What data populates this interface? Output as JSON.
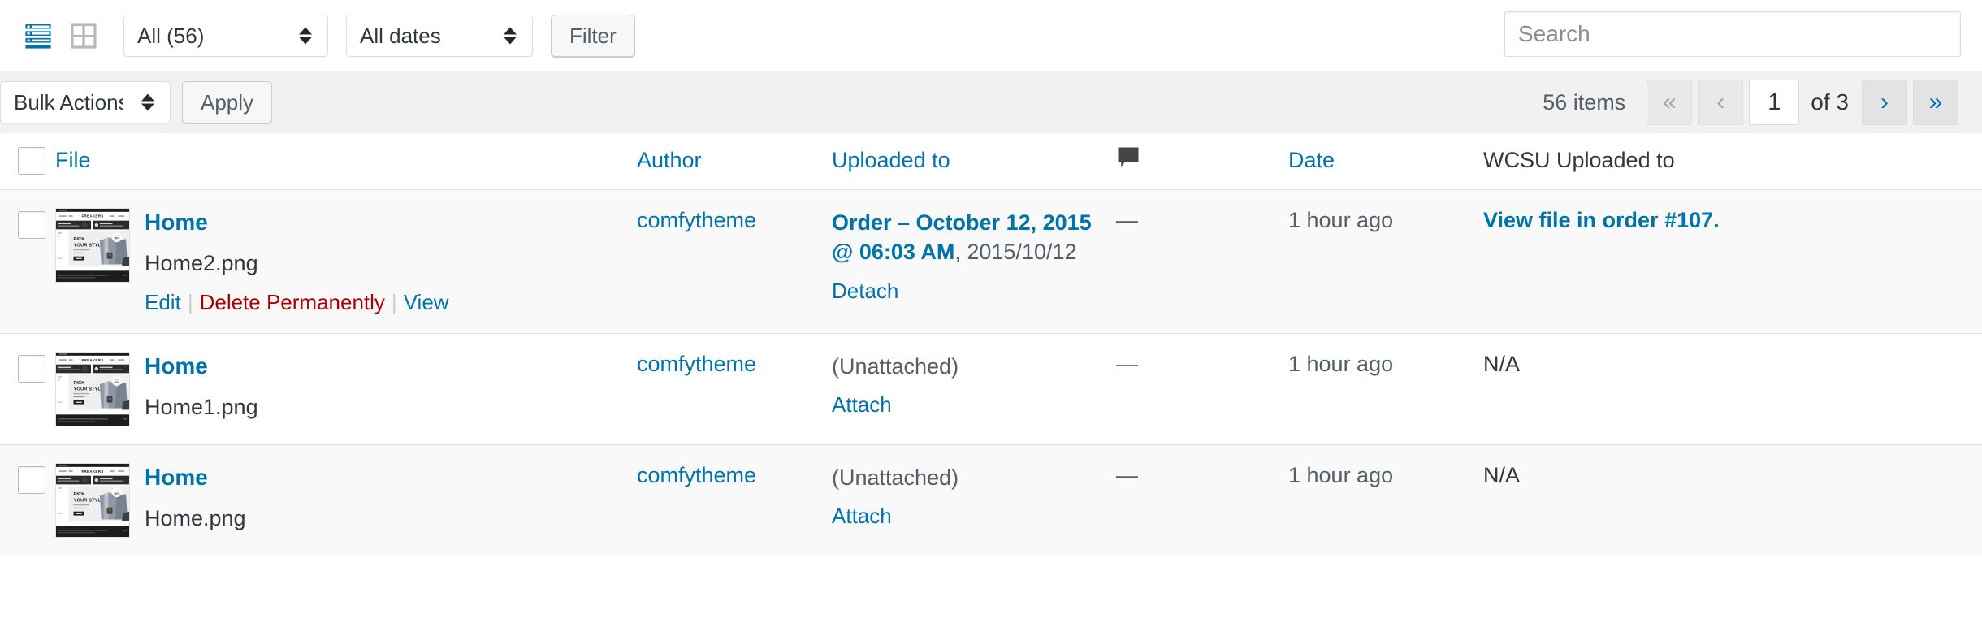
{
  "toolbar": {
    "view_list_icon": "list-view-icon",
    "view_grid_icon": "grid-view-icon",
    "status_filter_value": "All (56)",
    "date_filter_value": "All dates",
    "filter_button_label": "Filter",
    "search_placeholder": "Search",
    "search_value": ""
  },
  "tablenav": {
    "bulk_actions_value": "Bulk Actions",
    "apply_button_label": "Apply",
    "items_count_label": "56 items",
    "first_page_label": "«",
    "prev_page_label": "‹",
    "current_page": "1",
    "total_pages_label": "of 3",
    "next_page_label": "›",
    "last_page_label": "»"
  },
  "table": {
    "columns": {
      "file": "File",
      "author": "Author",
      "uploaded_to": "Uploaded to",
      "comments_icon": "comment-bubble-icon",
      "date": "Date",
      "wcsu_uploaded_to": "WCSU Uploaded to"
    },
    "rows": [
      {
        "title": "Home",
        "filename": "Home2.png",
        "actions": {
          "edit": "Edit",
          "delete": "Delete Permanently",
          "view": "View"
        },
        "author": "comfytheme",
        "uploaded_to_link": "Order – October 12, 2015 @ 06:03 AM",
        "uploaded_to_suffix": ", 2015/10/12",
        "uploaded_to_action": "Detach",
        "comments": "—",
        "date": "1 hour ago",
        "wcsu": "View file in order #107.",
        "wcsu_is_link": true
      },
      {
        "title": "Home",
        "filename": "Home1.png",
        "actions": null,
        "author": "comfytheme",
        "uploaded_to_link": "",
        "uploaded_to_suffix": "(Unattached)",
        "uploaded_to_action": "Attach",
        "comments": "—",
        "date": "1 hour ago",
        "wcsu": "N/A",
        "wcsu_is_link": false
      },
      {
        "title": "Home",
        "filename": "Home.png",
        "actions": null,
        "author": "comfytheme",
        "uploaded_to_link": "",
        "uploaded_to_suffix": "(Unattached)",
        "uploaded_to_action": "Attach",
        "comments": "—",
        "date": "1 hour ago",
        "wcsu": "N/A",
        "wcsu_is_link": false
      }
    ]
  },
  "thumbnail": {
    "brand_text": "FREAKERS",
    "hero_line1": "PICK",
    "hero_line2": "YOUR STYLE",
    "badge_text": "50%"
  },
  "colors": {
    "link": "#0073aa",
    "trash": "#a00",
    "text": "#32373c",
    "muted": "#555d66",
    "nav_bg": "#f1f1f1",
    "row_alt": "#f9f9f9"
  }
}
